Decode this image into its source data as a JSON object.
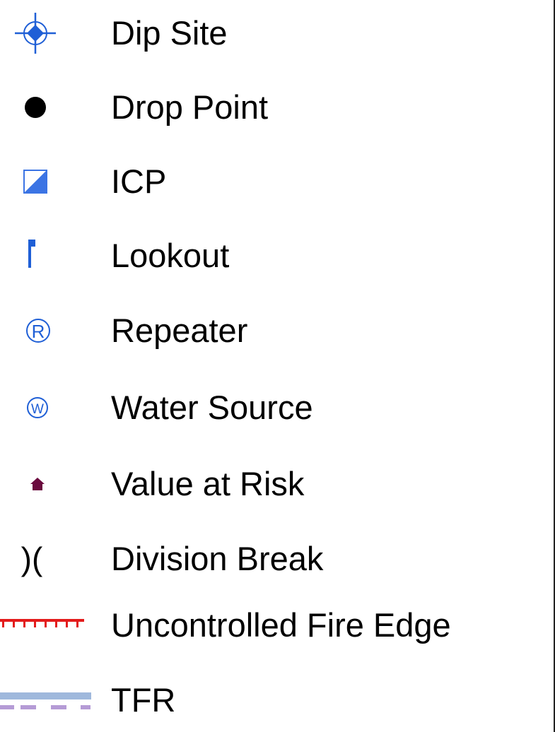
{
  "legend": {
    "items": [
      {
        "label": "Dip Site",
        "icon": "dip-site-icon"
      },
      {
        "label": "Drop Point",
        "icon": "drop-point-icon"
      },
      {
        "label": "ICP",
        "icon": "icp-icon"
      },
      {
        "label": "Lookout",
        "icon": "lookout-icon"
      },
      {
        "label": "Repeater",
        "icon": "repeater-icon",
        "glyph": "R"
      },
      {
        "label": "Water Source",
        "icon": "water-source-icon",
        "glyph": "W"
      },
      {
        "label": "Value at Risk",
        "icon": "value-at-risk-icon"
      },
      {
        "label": "Division Break",
        "icon": "division-break-icon",
        "glyph": ")("
      },
      {
        "label": "Uncontrolled Fire Edge",
        "icon": "uncontrolled-fire-edge-icon"
      },
      {
        "label": "TFR",
        "icon": "tfr-icon"
      }
    ]
  },
  "colors": {
    "symbol_blue": "#1f5fd6",
    "icp_blue": "#3b74e4",
    "value_at_risk": "#6b0a3e",
    "fire_edge_red": "#e31b1b",
    "tfr_blue": "#9fb8dc",
    "tfr_purple": "#b59bd6",
    "text": "#000000"
  }
}
